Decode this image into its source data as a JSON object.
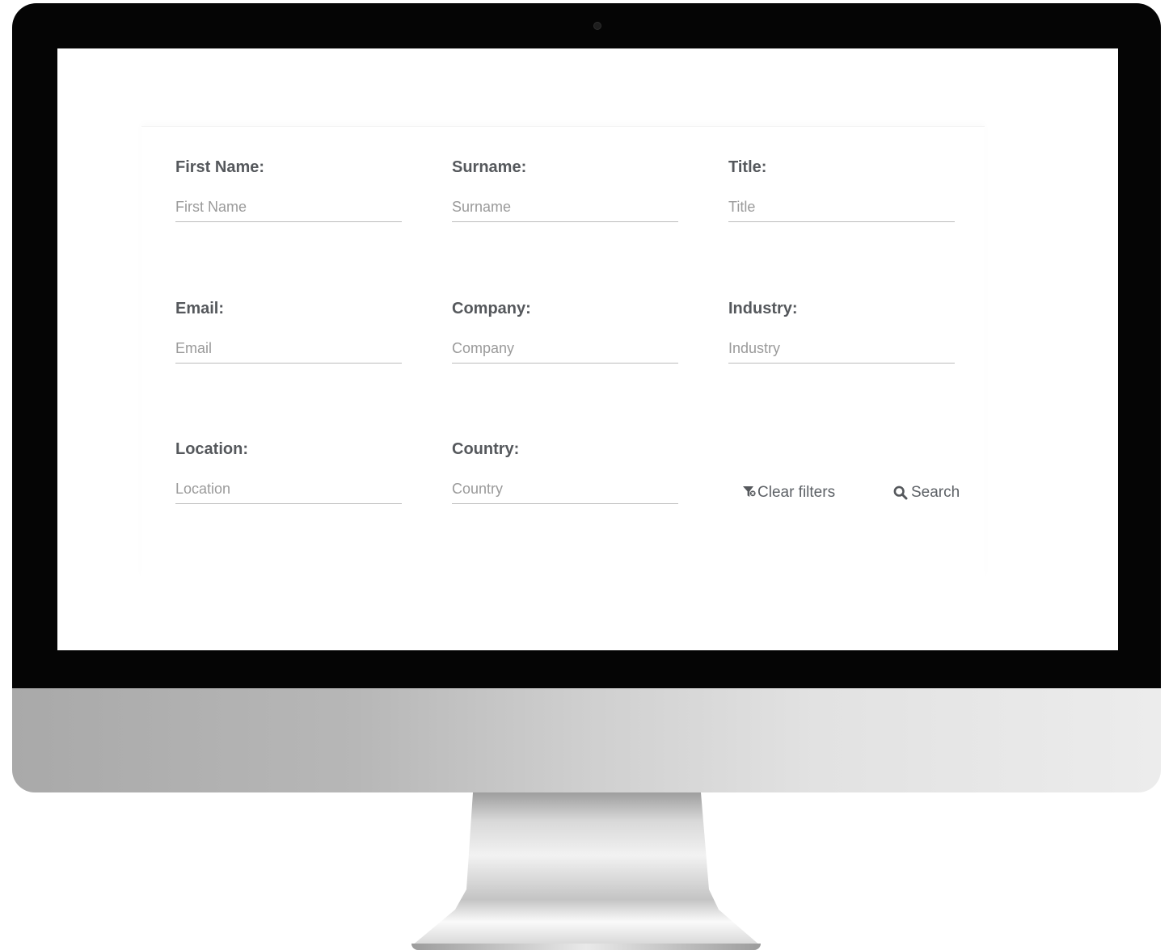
{
  "form": {
    "first_name": {
      "label": "First Name:",
      "placeholder": "First Name"
    },
    "surname": {
      "label": "Surname:",
      "placeholder": "Surname"
    },
    "title": {
      "label": "Title:",
      "placeholder": "Title"
    },
    "email": {
      "label": "Email:",
      "placeholder": "Email"
    },
    "company": {
      "label": "Company:",
      "placeholder": "Company"
    },
    "industry": {
      "label": "Industry:",
      "placeholder": "Industry"
    },
    "location": {
      "label": "Location:",
      "placeholder": "Location"
    },
    "country": {
      "label": "Country:",
      "placeholder": "Country"
    }
  },
  "actions": {
    "clear_filters_label": "Clear filters",
    "clear_filters_icon": "filter-clear-icon",
    "search_label": "Search",
    "search_icon": "search-icon"
  },
  "colors": {
    "label_text": "#55585c",
    "placeholder_text": "#9a9a9a",
    "underline": "#bdbdbd",
    "bezel": "#050505"
  }
}
